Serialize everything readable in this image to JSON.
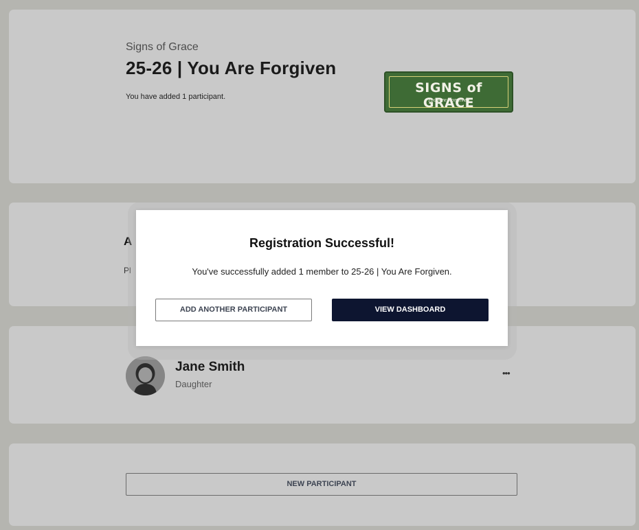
{
  "event": {
    "organization": "Signs of Grace",
    "title": "25-26 | You Are Forgiven",
    "participant_count_text": "You have added 1 participant.",
    "logo": {
      "main_text": "SIGNS of GRACE",
      "sub_text": "You Are Forgiven",
      "color": "#3e6b35"
    }
  },
  "about": {
    "heading_visible": "A",
    "text_visible": "Pl"
  },
  "member": {
    "name": "Jane Smith",
    "relation": "Daughter",
    "more_icon": "ellipsis-icon"
  },
  "new_participant": {
    "label": "NEW PARTICIPANT"
  },
  "modal": {
    "title": "Registration Successful!",
    "message": "You've successfully added 1 member to 25-26 | You Are Forgiven.",
    "add_another_label": "ADD ANOTHER PARTICIPANT",
    "view_dashboard_label": "VIEW DASHBOARD",
    "primary_color": "#0d1530"
  }
}
